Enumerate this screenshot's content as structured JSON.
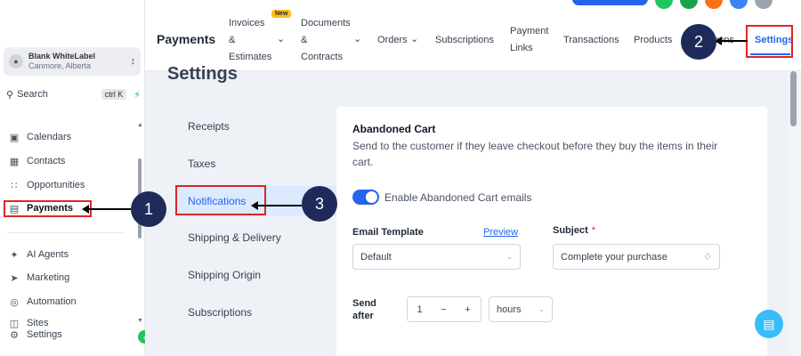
{
  "sidebar": {
    "account": {
      "name": "Blank WhiteLabel",
      "location": "Canmore, Alberta"
    },
    "search": {
      "label": "Search",
      "shortcut": "ctrl K"
    },
    "items": [
      {
        "label": "Calendars",
        "icon": "calendar-icon"
      },
      {
        "label": "Contacts",
        "icon": "contacts-icon"
      },
      {
        "label": "Opportunities",
        "icon": "opportunities-icon"
      },
      {
        "label": "Payments",
        "icon": "payments-icon",
        "active": true
      },
      {
        "label": "AI Agents",
        "icon": "ai-agents-icon"
      },
      {
        "label": "Marketing",
        "icon": "send-icon"
      },
      {
        "label": "Automation",
        "icon": "automation-icon"
      },
      {
        "label": "Sites",
        "icon": "sites-icon"
      },
      {
        "label": "Settings",
        "icon": "gear-icon"
      }
    ]
  },
  "topnav": {
    "title": "Payments",
    "badge_new": "New",
    "tabs": [
      {
        "lines": [
          "Invoices",
          "&",
          "Estimates"
        ],
        "has_caret": true
      },
      {
        "lines": [
          "Documents",
          "&",
          "Contracts"
        ],
        "has_caret": true
      },
      {
        "label": "Orders",
        "has_caret": true
      },
      {
        "label": "Subscriptions"
      },
      {
        "lines": [
          "Payment",
          "Links"
        ]
      },
      {
        "label": "Transactions"
      },
      {
        "label": "Products"
      },
      {
        "label": "Coupons"
      },
      {
        "label": "Settings",
        "active": true
      }
    ]
  },
  "page": {
    "title": "Settings",
    "menu": [
      {
        "label": "Receipts"
      },
      {
        "label": "Taxes"
      },
      {
        "label": "Notifications",
        "active": true
      },
      {
        "label": "Shipping & Delivery"
      },
      {
        "label": "Shipping Origin"
      },
      {
        "label": "Subscriptions"
      }
    ]
  },
  "abandoned_cart": {
    "title": "Abandoned Cart",
    "description": "Send to the customer if they leave checkout before they buy the items in their cart.",
    "toggle_label": "Enable Abandoned Cart emails",
    "toggle_on": true,
    "email_template_label": "Email Template",
    "preview_link": "Preview",
    "email_template_value": "Default",
    "subject_label": "Subject",
    "subject_required": "*",
    "subject_value": "Complete your purchase",
    "send_after_label_1": "Send",
    "send_after_label_2": "after",
    "send_after_value": "1",
    "send_after_unit": "hours"
  },
  "annotations": {
    "marker_1": "1",
    "marker_2": "2",
    "marker_3": "3"
  },
  "colors": {
    "accent": "#2563eb",
    "highlight": "#dc2626",
    "marker": "#1e2a5a",
    "success": "#22c55e"
  }
}
